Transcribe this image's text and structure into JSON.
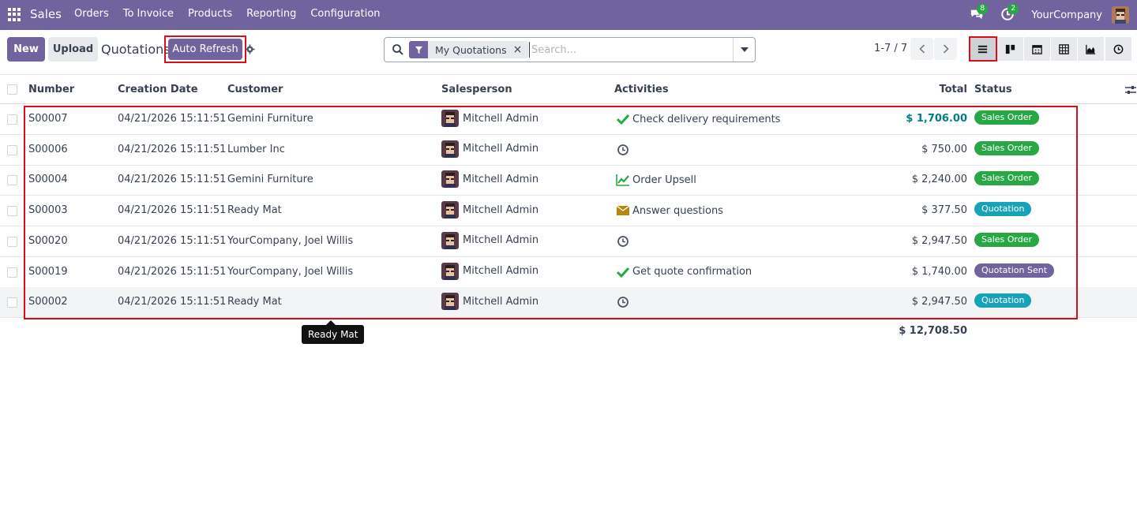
{
  "navbar": {
    "app_name": "Sales",
    "menu": [
      "Orders",
      "To Invoice",
      "Products",
      "Reporting",
      "Configuration"
    ],
    "messages_count": "8",
    "activities_count": "2",
    "company": "YourCompany"
  },
  "control": {
    "new_label": "New",
    "upload_label": "Upload",
    "title": "Quotations",
    "refresh_label": "Auto Refresh",
    "facet_label": "My Quotations",
    "search_placeholder": "Search...",
    "pager": "1-7 / 7"
  },
  "table": {
    "headers": {
      "number": "Number",
      "date": "Creation Date",
      "customer": "Customer",
      "salesperson": "Salesperson",
      "activities": "Activities",
      "total": "Total",
      "status": "Status"
    },
    "rows": [
      {
        "number": "S00007",
        "date": "04/21/2026 15:11:51",
        "customer": "Gemini Furniture",
        "salesperson": "Mitchell Admin",
        "activity_icon": "check-icon",
        "activity": "Check delivery requirements",
        "total": "$ 1,706.00",
        "status": "Sales Order",
        "status_color": "#28a745"
      },
      {
        "number": "S00006",
        "date": "04/21/2026 15:11:51",
        "customer": "Lumber Inc",
        "salesperson": "Mitchell Admin",
        "activity_icon": "clock-icon",
        "activity": "",
        "total": "$ 750.00",
        "status": "Sales Order",
        "status_color": "#28a745"
      },
      {
        "number": "S00004",
        "date": "04/21/2026 15:11:51",
        "customer": "Gemini Furniture",
        "salesperson": "Mitchell Admin",
        "activity_icon": "chart-line-icon",
        "activity": "Order Upsell",
        "total": "$ 2,240.00",
        "status": "Sales Order",
        "status_color": "#28a745"
      },
      {
        "number": "S00003",
        "date": "04/21/2026 15:11:51",
        "customer": "Ready Mat",
        "salesperson": "Mitchell Admin",
        "activity_icon": "envelope-icon",
        "activity": "Answer questions",
        "total": "$ 377.50",
        "status": "Quotation",
        "status_color": "#17a2b8"
      },
      {
        "number": "S00020",
        "date": "04/21/2026 15:11:51",
        "customer": "YourCompany, Joel Willis",
        "salesperson": "Mitchell Admin",
        "activity_icon": "clock-icon",
        "activity": "",
        "total": "$ 2,947.50",
        "status": "Sales Order",
        "status_color": "#28a745"
      },
      {
        "number": "S00019",
        "date": "04/21/2026 15:11:51",
        "customer": "YourCompany, Joel Willis",
        "salesperson": "Mitchell Admin",
        "activity_icon": "check-icon",
        "activity": "Get quote confirmation",
        "total": "$ 1,740.00",
        "status": "Quotation Sent",
        "status_color": "#71639e"
      },
      {
        "number": "S00002",
        "date": "04/21/2026 15:11:51",
        "customer": "Ready Mat",
        "salesperson": "Mitchell Admin",
        "activity_icon": "clock-icon",
        "activity": "",
        "total": "$ 2,947.50",
        "status": "Quotation",
        "status_color": "#17a2b8"
      }
    ],
    "grand_total": "$ 12,708.50"
  },
  "tooltip": "Ready Mat"
}
